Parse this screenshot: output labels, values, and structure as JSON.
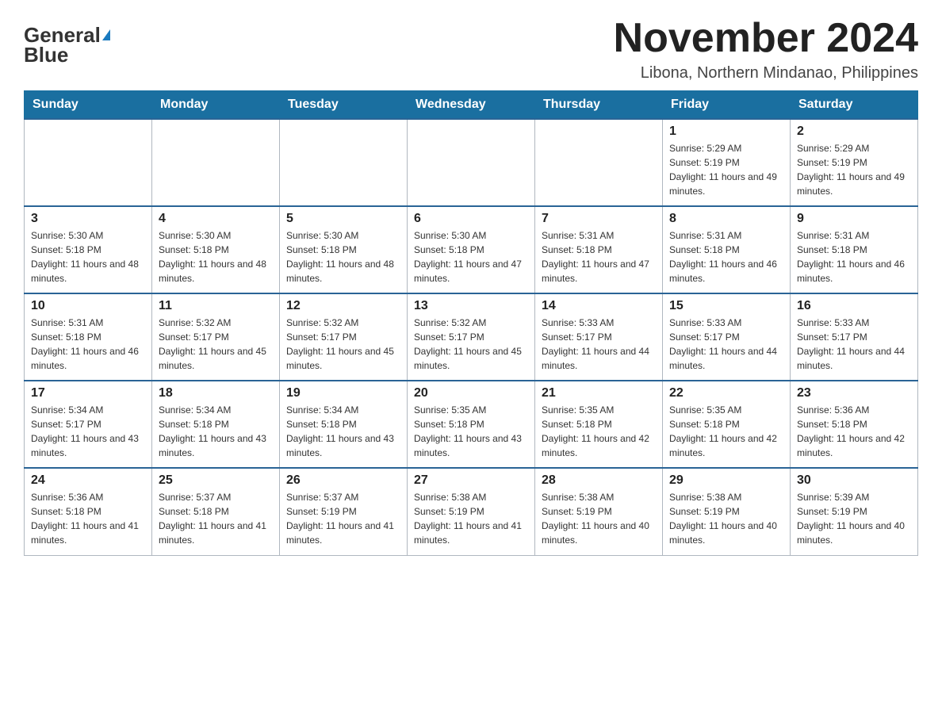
{
  "logo": {
    "part1": "General",
    "part2": "Blue"
  },
  "title": "November 2024",
  "location": "Libona, Northern Mindanao, Philippines",
  "weekdays": [
    "Sunday",
    "Monday",
    "Tuesday",
    "Wednesday",
    "Thursday",
    "Friday",
    "Saturday"
  ],
  "weeks": [
    [
      {
        "date": "",
        "info": ""
      },
      {
        "date": "",
        "info": ""
      },
      {
        "date": "",
        "info": ""
      },
      {
        "date": "",
        "info": ""
      },
      {
        "date": "",
        "info": ""
      },
      {
        "date": "1",
        "info": "Sunrise: 5:29 AM\nSunset: 5:19 PM\nDaylight: 11 hours and 49 minutes."
      },
      {
        "date": "2",
        "info": "Sunrise: 5:29 AM\nSunset: 5:19 PM\nDaylight: 11 hours and 49 minutes."
      }
    ],
    [
      {
        "date": "3",
        "info": "Sunrise: 5:30 AM\nSunset: 5:18 PM\nDaylight: 11 hours and 48 minutes."
      },
      {
        "date": "4",
        "info": "Sunrise: 5:30 AM\nSunset: 5:18 PM\nDaylight: 11 hours and 48 minutes."
      },
      {
        "date": "5",
        "info": "Sunrise: 5:30 AM\nSunset: 5:18 PM\nDaylight: 11 hours and 48 minutes."
      },
      {
        "date": "6",
        "info": "Sunrise: 5:30 AM\nSunset: 5:18 PM\nDaylight: 11 hours and 47 minutes."
      },
      {
        "date": "7",
        "info": "Sunrise: 5:31 AM\nSunset: 5:18 PM\nDaylight: 11 hours and 47 minutes."
      },
      {
        "date": "8",
        "info": "Sunrise: 5:31 AM\nSunset: 5:18 PM\nDaylight: 11 hours and 46 minutes."
      },
      {
        "date": "9",
        "info": "Sunrise: 5:31 AM\nSunset: 5:18 PM\nDaylight: 11 hours and 46 minutes."
      }
    ],
    [
      {
        "date": "10",
        "info": "Sunrise: 5:31 AM\nSunset: 5:18 PM\nDaylight: 11 hours and 46 minutes."
      },
      {
        "date": "11",
        "info": "Sunrise: 5:32 AM\nSunset: 5:17 PM\nDaylight: 11 hours and 45 minutes."
      },
      {
        "date": "12",
        "info": "Sunrise: 5:32 AM\nSunset: 5:17 PM\nDaylight: 11 hours and 45 minutes."
      },
      {
        "date": "13",
        "info": "Sunrise: 5:32 AM\nSunset: 5:17 PM\nDaylight: 11 hours and 45 minutes."
      },
      {
        "date": "14",
        "info": "Sunrise: 5:33 AM\nSunset: 5:17 PM\nDaylight: 11 hours and 44 minutes."
      },
      {
        "date": "15",
        "info": "Sunrise: 5:33 AM\nSunset: 5:17 PM\nDaylight: 11 hours and 44 minutes."
      },
      {
        "date": "16",
        "info": "Sunrise: 5:33 AM\nSunset: 5:17 PM\nDaylight: 11 hours and 44 minutes."
      }
    ],
    [
      {
        "date": "17",
        "info": "Sunrise: 5:34 AM\nSunset: 5:17 PM\nDaylight: 11 hours and 43 minutes."
      },
      {
        "date": "18",
        "info": "Sunrise: 5:34 AM\nSunset: 5:18 PM\nDaylight: 11 hours and 43 minutes."
      },
      {
        "date": "19",
        "info": "Sunrise: 5:34 AM\nSunset: 5:18 PM\nDaylight: 11 hours and 43 minutes."
      },
      {
        "date": "20",
        "info": "Sunrise: 5:35 AM\nSunset: 5:18 PM\nDaylight: 11 hours and 43 minutes."
      },
      {
        "date": "21",
        "info": "Sunrise: 5:35 AM\nSunset: 5:18 PM\nDaylight: 11 hours and 42 minutes."
      },
      {
        "date": "22",
        "info": "Sunrise: 5:35 AM\nSunset: 5:18 PM\nDaylight: 11 hours and 42 minutes."
      },
      {
        "date": "23",
        "info": "Sunrise: 5:36 AM\nSunset: 5:18 PM\nDaylight: 11 hours and 42 minutes."
      }
    ],
    [
      {
        "date": "24",
        "info": "Sunrise: 5:36 AM\nSunset: 5:18 PM\nDaylight: 11 hours and 41 minutes."
      },
      {
        "date": "25",
        "info": "Sunrise: 5:37 AM\nSunset: 5:18 PM\nDaylight: 11 hours and 41 minutes."
      },
      {
        "date": "26",
        "info": "Sunrise: 5:37 AM\nSunset: 5:19 PM\nDaylight: 11 hours and 41 minutes."
      },
      {
        "date": "27",
        "info": "Sunrise: 5:38 AM\nSunset: 5:19 PM\nDaylight: 11 hours and 41 minutes."
      },
      {
        "date": "28",
        "info": "Sunrise: 5:38 AM\nSunset: 5:19 PM\nDaylight: 11 hours and 40 minutes."
      },
      {
        "date": "29",
        "info": "Sunrise: 5:38 AM\nSunset: 5:19 PM\nDaylight: 11 hours and 40 minutes."
      },
      {
        "date": "30",
        "info": "Sunrise: 5:39 AM\nSunset: 5:19 PM\nDaylight: 11 hours and 40 minutes."
      }
    ]
  ]
}
